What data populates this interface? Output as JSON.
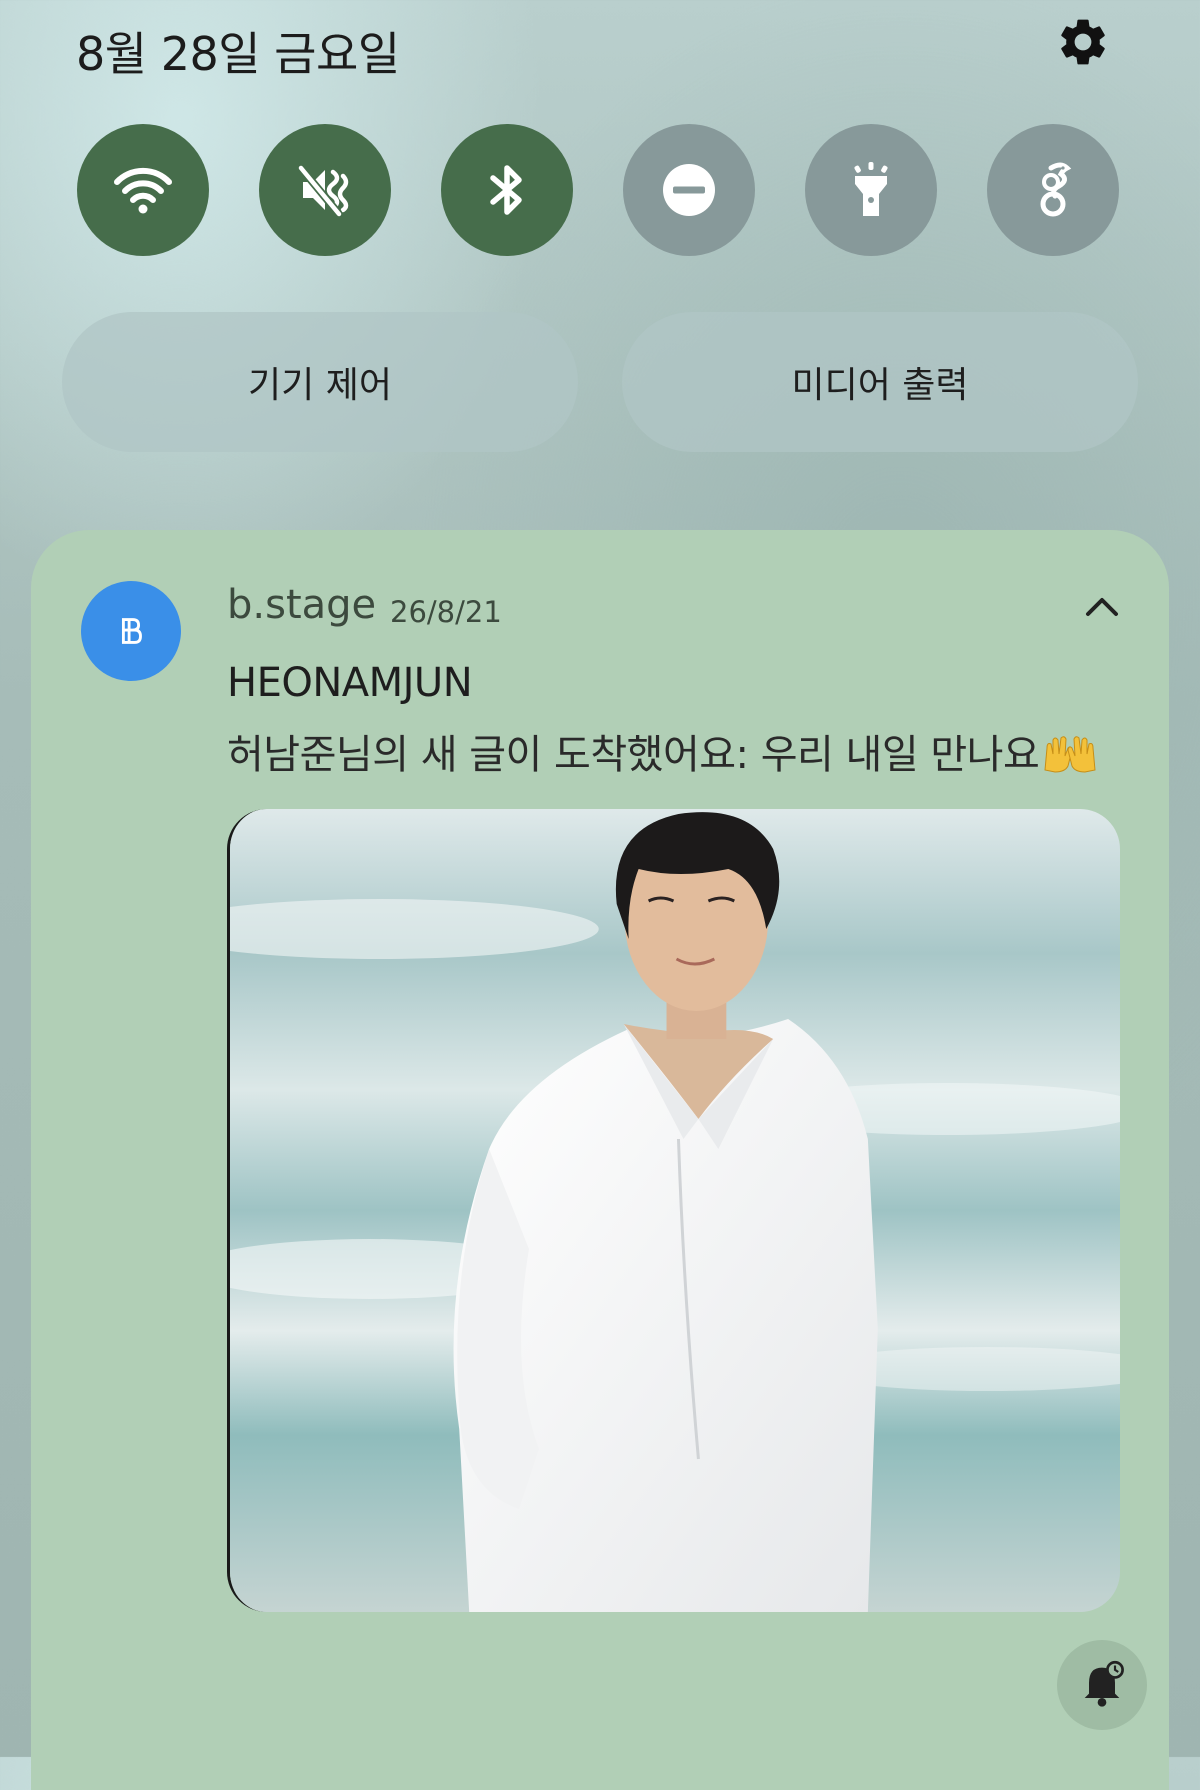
{
  "header": {
    "date": "8월 28일 금요일",
    "settings_icon": "gear-icon"
  },
  "quick_toggles": [
    {
      "name": "wifi",
      "icon": "wifi-icon",
      "state": "on"
    },
    {
      "name": "sound",
      "icon": "vibrate-mute-icon",
      "state": "on"
    },
    {
      "name": "bluetooth",
      "icon": "bluetooth-icon",
      "state": "on"
    },
    {
      "name": "do-not-disturb",
      "icon": "minus-circle-icon",
      "state": "off"
    },
    {
      "name": "flashlight",
      "icon": "flashlight-icon",
      "state": "off"
    },
    {
      "name": "wireguard",
      "icon": "dragon-icon",
      "state": "off"
    }
  ],
  "controls": {
    "device_control": "기기 제어",
    "media_output": "미디어 출력"
  },
  "notification": {
    "app_name": "b.stage",
    "time": "26/8/21",
    "title": "HEONAMJUN",
    "text": "허남준님의 새 글이 도착했어요: 우리 내일 만나요",
    "emoji": "raising-hands-icon",
    "image": "photo-man-white-shirt-beach"
  },
  "colors": {
    "toggle_on": "#466d4b",
    "toggle_off": "#87999a",
    "card_background": "#b1cfb6",
    "app_icon": "#3a8fe8"
  }
}
